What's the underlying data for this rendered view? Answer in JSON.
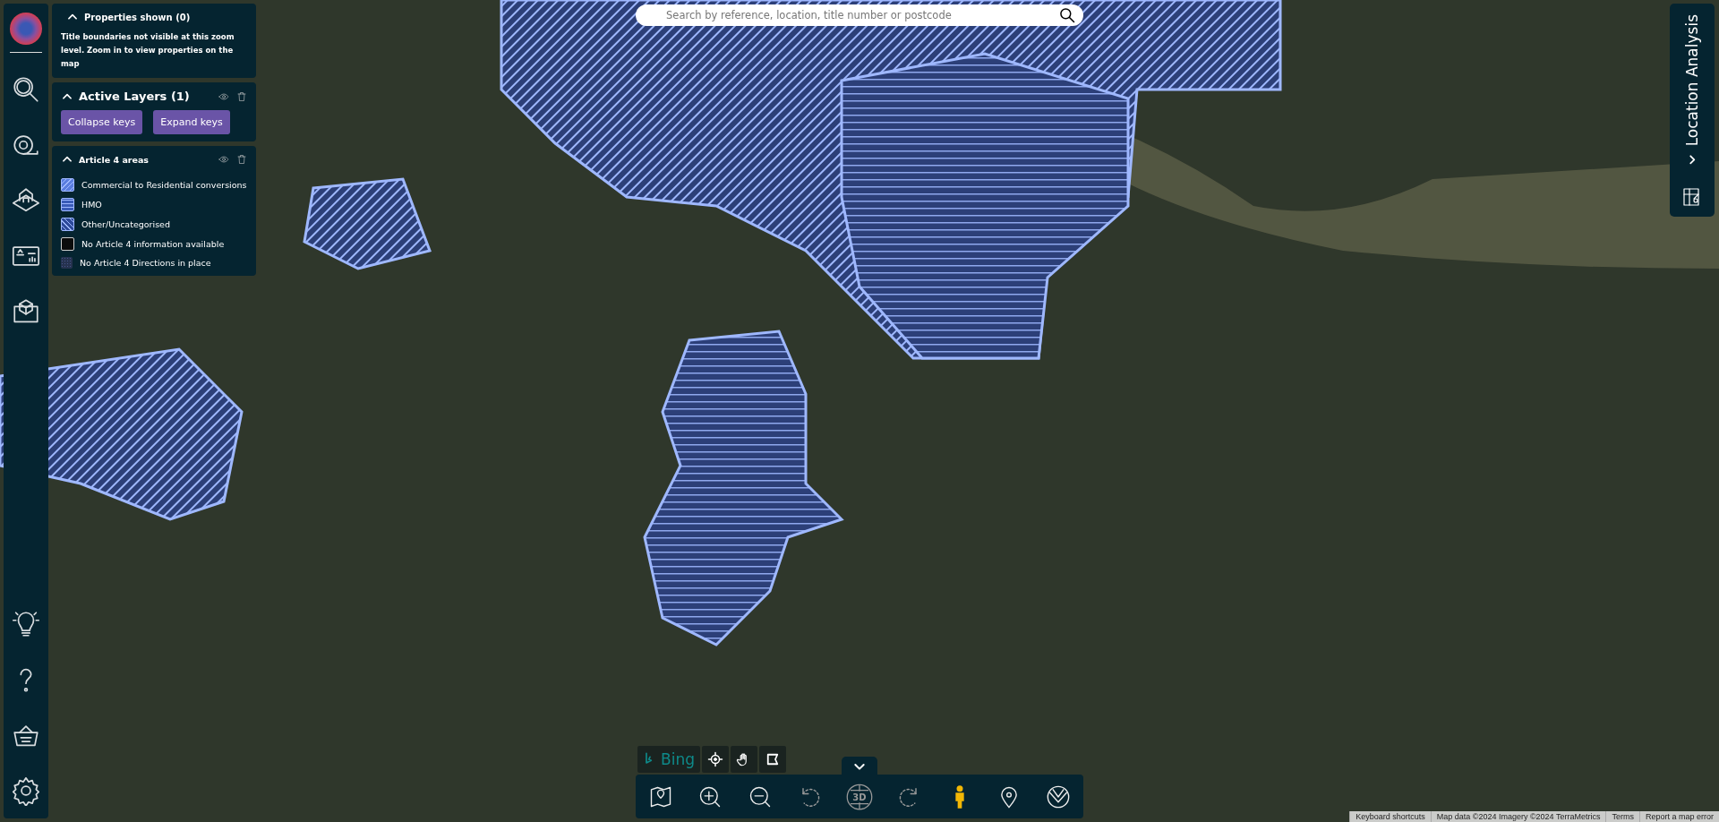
{
  "properties_panel": {
    "title": "Properties shown (0)",
    "expanded": true,
    "message": "Title boundaries not visible at this zoom level. Zoom in to view properties on the map"
  },
  "active_layers": {
    "title": "Active Layers (1)",
    "expanded": true,
    "buttons": [
      "Collapse keys",
      "Expand keys"
    ]
  },
  "layer": {
    "title": "Article 4 areas",
    "expanded": true,
    "legend": [
      {
        "kind": "diagonal",
        "label": "Commercial to Residential conversions"
      },
      {
        "kind": "horizontal",
        "label": "HMO"
      },
      {
        "kind": "reverse",
        "label": "Other/Uncategorised"
      },
      {
        "kind": "solid",
        "label": "No Article 4 information available"
      },
      {
        "kind": "dotted",
        "label": "No Article 4 Directions in place"
      }
    ]
  },
  "search": {
    "placeholder": "Search by reference, location, title number or postcode"
  },
  "side_tab": {
    "title": "Location Analysis"
  },
  "map_controls": {
    "brand": "Bing"
  },
  "toolbar": [
    {
      "kind": "map",
      "disabled": false
    },
    {
      "kind": "zoom-in",
      "disabled": false
    },
    {
      "kind": "zoom-out",
      "disabled": false
    },
    {
      "kind": "undo",
      "disabled": true
    },
    {
      "kind": "globe",
      "disabled": true,
      "label": "3D"
    },
    {
      "kind": "redo",
      "disabled": true
    },
    {
      "kind": "person",
      "disabled": false
    },
    {
      "kind": "pin",
      "disabled": false
    },
    {
      "kind": "layers",
      "disabled": false
    }
  ],
  "attribution": [
    "Keyboard shortcuts",
    "Map data ©2024 Imagery ©2024 TerraMetrics",
    "Terms",
    "Report a map error"
  ]
}
